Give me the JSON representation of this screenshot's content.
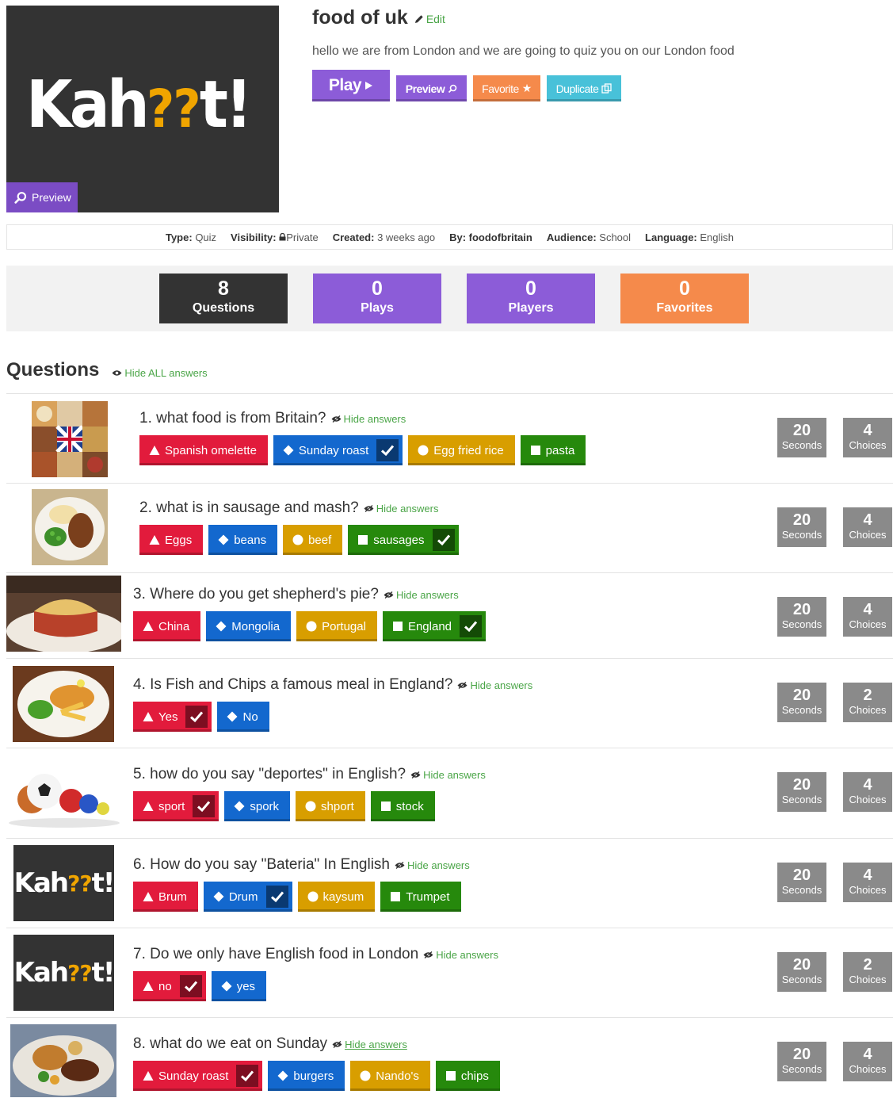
{
  "kahoot": {
    "cover_logo_main": "Kah",
    "cover_logo_q": "??",
    "cover_logo_end": "t!",
    "cover_preview_label": "Preview",
    "title": "food of uk",
    "edit_label": "Edit",
    "description": "hello we are from London and we are going to quiz you on our London food"
  },
  "actions": {
    "play_label": "Play",
    "preview_label": "Preview",
    "favorite_label": "Favorite",
    "duplicate_label": "Duplicate"
  },
  "meta": {
    "type_label": "Type:",
    "type_value": "Quiz",
    "visibility_label": "Visibility:",
    "visibility_value": "Private",
    "created_label": "Created:",
    "created_value": "3 weeks ago",
    "by_label": "By:",
    "by_value": "foodofbritain",
    "audience_label": "Audience:",
    "audience_value": "School",
    "language_label": "Language:",
    "language_value": "English"
  },
  "stats": {
    "questions": {
      "value": "8",
      "label": "Questions"
    },
    "plays": {
      "value": "0",
      "label": "Plays"
    },
    "players": {
      "value": "0",
      "label": "Players"
    },
    "favorites": {
      "value": "0",
      "label": "Favorites"
    }
  },
  "questions_section": {
    "heading": "Questions",
    "hide_all_label": "Hide ALL answers",
    "hide_answers_label": "Hide answers",
    "seconds_label": "Seconds",
    "choices_label": "Choices",
    "items": [
      {
        "text": "1. what food is from Britain?",
        "time": "20",
        "choices": "4",
        "answers": [
          {
            "text": "Spanish omelette",
            "color": "red",
            "correct": false
          },
          {
            "text": "Sunday roast",
            "color": "blue",
            "correct": true
          },
          {
            "text": "Egg fried rice",
            "color": "yellow",
            "correct": false
          },
          {
            "text": "pasta",
            "color": "green",
            "correct": false
          }
        ]
      },
      {
        "text": "2. what is in sausage and mash?",
        "time": "20",
        "choices": "4",
        "answers": [
          {
            "text": "Eggs",
            "color": "red",
            "correct": false
          },
          {
            "text": "beans",
            "color": "blue",
            "correct": false
          },
          {
            "text": "beef",
            "color": "yellow",
            "correct": false
          },
          {
            "text": "sausages",
            "color": "green",
            "correct": true
          }
        ]
      },
      {
        "text": "3. Where do you get shepherd's pie?",
        "time": "20",
        "choices": "4",
        "answers": [
          {
            "text": "China",
            "color": "red",
            "correct": false
          },
          {
            "text": "Mongolia",
            "color": "blue",
            "correct": false
          },
          {
            "text": "Portugal",
            "color": "yellow",
            "correct": false
          },
          {
            "text": "England",
            "color": "green",
            "correct": true
          }
        ]
      },
      {
        "text": "4. Is Fish and Chips a famous meal in England?",
        "time": "20",
        "choices": "2",
        "answers": [
          {
            "text": "Yes",
            "color": "red",
            "correct": true
          },
          {
            "text": "No",
            "color": "blue",
            "correct": false
          }
        ]
      },
      {
        "text": "5. how do you say \"deportes\" in English?",
        "time": "20",
        "choices": "4",
        "answers": [
          {
            "text": "sport",
            "color": "red",
            "correct": true
          },
          {
            "text": "spork",
            "color": "blue",
            "correct": false
          },
          {
            "text": "shport",
            "color": "yellow",
            "correct": false
          },
          {
            "text": "stock",
            "color": "green",
            "correct": false
          }
        ]
      },
      {
        "text": "6. How do you say \"Bateria\" In English",
        "time": "20",
        "choices": "4",
        "answers": [
          {
            "text": "Brum",
            "color": "red",
            "correct": false
          },
          {
            "text": "Drum",
            "color": "blue",
            "correct": true
          },
          {
            "text": "kaysum",
            "color": "yellow",
            "correct": false
          },
          {
            "text": "Trumpet",
            "color": "green",
            "correct": false
          }
        ]
      },
      {
        "text": "7. Do we only have English food in London",
        "time": "20",
        "choices": "2",
        "answers": [
          {
            "text": "no",
            "color": "red",
            "correct": true
          },
          {
            "text": "yes",
            "color": "blue",
            "correct": false
          }
        ]
      },
      {
        "text": "8. what do we eat on Sunday",
        "time": "20",
        "choices": "4",
        "answers": [
          {
            "text": "Sunday roast",
            "color": "red",
            "correct": true
          },
          {
            "text": "burgers",
            "color": "blue",
            "correct": false
          },
          {
            "text": "Nando's",
            "color": "yellow",
            "correct": false
          },
          {
            "text": "chips",
            "color": "green",
            "correct": false
          }
        ]
      }
    ]
  },
  "colors": {
    "purple": "#8c5cd8",
    "orange": "#f58a4b",
    "cyan": "#48c1d9",
    "dark": "#333333",
    "link_green": "#4aa547",
    "answer_red": "#e21b3c",
    "answer_blue": "#1368ce",
    "answer_yellow": "#d89e00",
    "answer_green": "#26890c",
    "badge_gray": "#8a8a8a"
  }
}
